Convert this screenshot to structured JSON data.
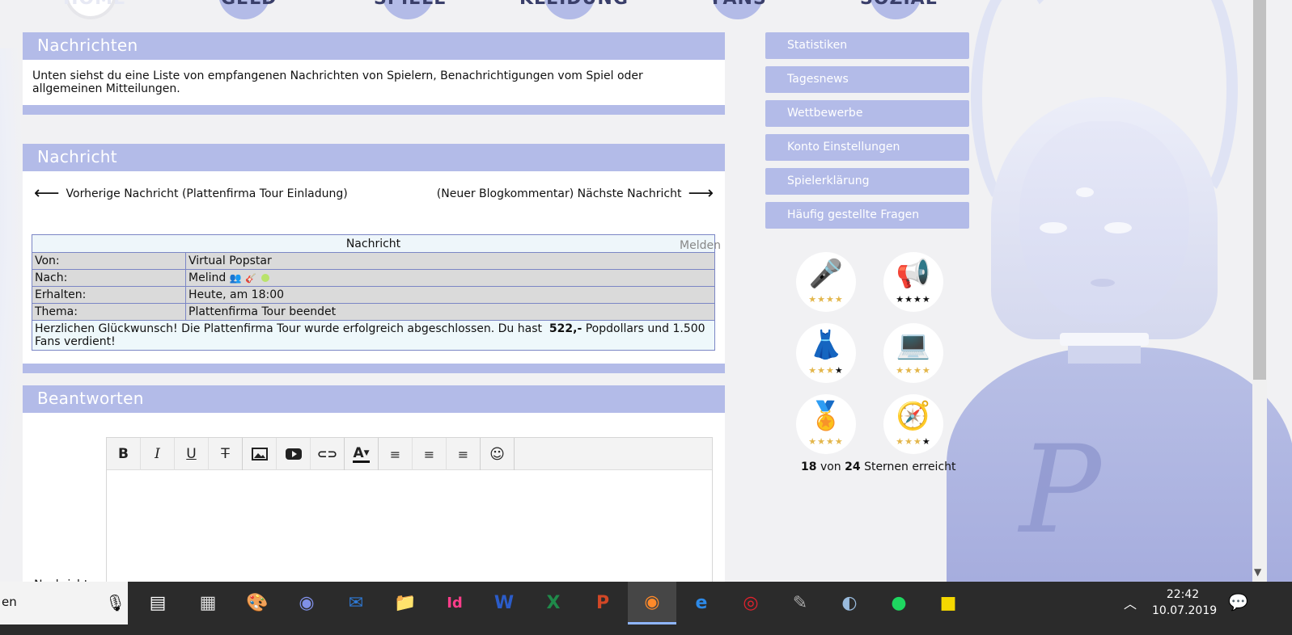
{
  "topnav": {
    "items": [
      "HOME",
      "GELD",
      "SPIELE",
      "KLEIDUNG",
      "FANS",
      "SOZIAL"
    ]
  },
  "news": {
    "title": "Nachrichten",
    "text": "Unten siehst du eine Liste von empfangenen Nachrichten von Spielern, Benachrichtigungen vom Spiel oder allgemeinen Mitteilungen."
  },
  "message": {
    "title": "Nachricht",
    "prev": "Vorherige Nachricht (Plattenfirma Tour Einladung)",
    "next": "(Neuer Blogkommentar) Nächste Nachricht",
    "table": {
      "header": "Nachricht",
      "report": "Melden",
      "from_label": "Von:",
      "from_value": "Virtual Popstar",
      "to_label": "Nach:",
      "to_value": "Melind",
      "received_label": "Erhalten:",
      "received_value": "Heute, am 18:00",
      "subject_label": "Thema:",
      "subject_value": "Plattenfirma Tour beendet",
      "body_pre": "Herzlichen Glückwunsch! Die Plattenfirma Tour wurde erfolgreich abgeschlossen. Du hast",
      "body_amount": "522,-",
      "body_post": "Popdollars und 1.500 Fans verdient!"
    }
  },
  "reply": {
    "title": "Beantworten",
    "label": "Nachricht",
    "toolbar": [
      "bold",
      "italic",
      "underline",
      "strikethrough",
      "image",
      "video",
      "link",
      "text-color",
      "align-left",
      "align-center",
      "align-right",
      "emoji"
    ]
  },
  "sidemenu": {
    "items": [
      "Statistiken",
      "Tagesnews",
      "Wettbewerbe",
      "Konto Einstellungen",
      "Spielerklärung",
      "Häufig gestellte Fragen"
    ]
  },
  "awards": {
    "items": [
      {
        "icon": "microphone-icon",
        "stars": 4,
        "color": "#6fd6c9"
      },
      {
        "icon": "megaphone-icon",
        "stars": 4,
        "color": "#111111"
      },
      {
        "icon": "dress-icon",
        "stars": 3,
        "color": "#e3b64b"
      },
      {
        "icon": "laptop-icon",
        "stars": 4,
        "color": "#6fd6c9"
      },
      {
        "icon": "medal-icon",
        "stars": 4,
        "color": "#6fd6c9"
      },
      {
        "icon": "compass-icon",
        "stars": 3,
        "color": "#e3b64b"
      }
    ],
    "earned": "18",
    "of": "von",
    "total": "24",
    "suffix": "Sternen erreicht"
  },
  "taskbar": {
    "search_text": "en",
    "time": "22:42",
    "date": "10.07.2019",
    "apps": [
      "task-view",
      "calculator",
      "paint",
      "discord",
      "outlook",
      "file-explorer",
      "indesign",
      "word",
      "excel",
      "powerpoint",
      "firefox",
      "edge",
      "creative-cloud",
      "gimp",
      "network",
      "spotify",
      "sticky-notes"
    ]
  }
}
